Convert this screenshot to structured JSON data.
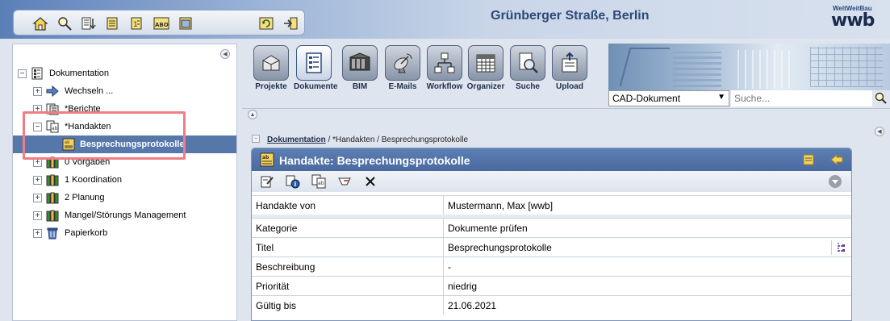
{
  "header": {
    "title": "Grünberger Straße, Berlin",
    "logo_small": "WeltWeitBau",
    "logo_big": "wwb",
    "toolbar_icons": [
      "home-icon",
      "search-tree-icon",
      "sort-down-icon",
      "list-edit-icon",
      "list-numbered-icon",
      "abc-icon",
      "window-icon",
      "refresh-icon",
      "logout-icon"
    ]
  },
  "tree": {
    "items": [
      {
        "label": "Dokumentation",
        "icon": "documentation-icon",
        "expander": "−"
      },
      {
        "label": "Wechseln ...",
        "icon": "arrow-right-icon",
        "expander": "+"
      },
      {
        "label": "*Berichte",
        "icon": "reports-icon",
        "expander": "+"
      },
      {
        "label": "*Handakten",
        "icon": "handakte-icon",
        "expander": "−"
      },
      {
        "label": "Besprechungsprotokolle",
        "icon": "handakte-folder-icon"
      },
      {
        "label": "0 Vorgaben",
        "icon": "binders-icon",
        "expander": "+"
      },
      {
        "label": "1 Koordination",
        "icon": "binders-icon",
        "expander": "+"
      },
      {
        "label": "2 Planung",
        "icon": "binders-icon",
        "expander": "+"
      },
      {
        "label": "Mangel/Störungs Management",
        "icon": "binders-icon",
        "expander": "+"
      },
      {
        "label": "Papierkorb",
        "icon": "trash-icon",
        "expander": "+"
      }
    ]
  },
  "modules": [
    {
      "label": "Projekte",
      "icon": "projects-icon"
    },
    {
      "label": "Dokumente",
      "icon": "documents-icon"
    },
    {
      "label": "BIM",
      "icon": "bim-icon"
    },
    {
      "label": "E-Mails",
      "icon": "satellite-icon"
    },
    {
      "label": "Workflow",
      "icon": "workflow-icon"
    },
    {
      "label": "Organizer",
      "icon": "calendar-icon"
    },
    {
      "label": "Suche",
      "icon": "search-doc-icon"
    },
    {
      "label": "Upload",
      "icon": "upload-icon"
    }
  ],
  "search": {
    "select_value": "CAD-Dokument",
    "placeholder": "Suche..."
  },
  "breadcrumb": {
    "root": "Dokumentation",
    "rest": " / *Handakten / Besprechungsprotokolle"
  },
  "card": {
    "title": "Handakte: Besprechungsprotokolle",
    "rows": [
      {
        "key": "Handakte von",
        "value": "Mustermann, Max [wwb]"
      },
      {
        "key": "Kategorie",
        "value": "Dokumente prüfen"
      },
      {
        "key": "Titel",
        "value": "Besprechungsprotokolle"
      },
      {
        "key": "Beschreibung",
        "value": "-"
      },
      {
        "key": "Priorität",
        "value": "niedrig"
      },
      {
        "key": "Gültig bis",
        "value": "21.06.2021"
      }
    ]
  },
  "colors": {
    "accent": "#4a6aa0",
    "highlight": "#f07c84",
    "selected_row": "#5577aa"
  }
}
